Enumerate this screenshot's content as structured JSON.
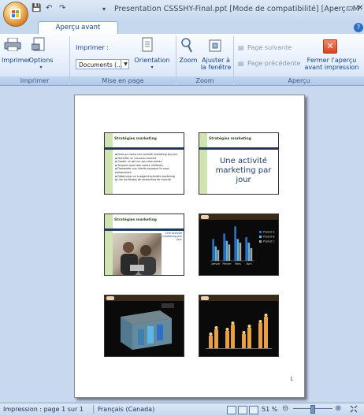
{
  "window": {
    "title": "Presentation CSSSHY-Final.ppt [Mode de compatibilité] [Aperç...M",
    "minimize_glyph": "–",
    "restore_glyph": "▭",
    "close_glyph": "✕",
    "qat_glyphs": [
      "💾",
      "↶",
      "↷",
      "▾"
    ]
  },
  "tabs": {
    "active": "Aperçu avant impression",
    "help_glyph": "?"
  },
  "ribbon": {
    "imprimer_group": {
      "label": "Imprimer",
      "print_label": "Imprimer",
      "options_label": "Options",
      "options_arrow": "▾"
    },
    "mise_en_page_group": {
      "label": "Mise en page",
      "print_what_label": "Imprimer :",
      "print_what_value": "Documents (...",
      "orientation_label": "Orientation",
      "orientation_arrow": "▾"
    },
    "zoom_group": {
      "label": "Zoom",
      "zoom_label": "Zoom",
      "fit_line1": "Ajuster à",
      "fit_line2": "la fenêtre"
    },
    "apercu_group": {
      "label": "Aperçu",
      "next_page": "Page suivante",
      "prev_page": "Page précédente",
      "close_line1": "Fermer l'aperçu",
      "close_line2": "avant impression"
    }
  },
  "slides": [
    {
      "title": "Stratégies marketing",
      "bullets": [
        "Faire au moins une activité marketing par jour",
        "Identifier un nouveau marché",
        "Garder un œil sur ses concurrents",
        "Toujours avoir des cartes d'affaires",
        "Demander aux clients pourquoi ils nous embauchent",
        "Déterminer un budget d'activités marketing",
        "Une les études de recherches de marché"
      ]
    },
    {
      "title": "Stratégies marketing",
      "big_text": "Une activité marketing par jour"
    },
    {
      "title": "Stratégies marketing",
      "small_text": "Une activité marketing par jour"
    }
  ],
  "chart_data": {
    "type": "bar",
    "categories": [
      "Janvier",
      "Février",
      "Mars",
      "Avril"
    ],
    "series": [
      {
        "name": "Produit A",
        "values": [
          60,
          75,
          95,
          65
        ]
      },
      {
        "name": "Produit B",
        "values": [
          40,
          55,
          60,
          50
        ]
      },
      {
        "name": "Produit C",
        "values": [
          30,
          45,
          50,
          35
        ]
      }
    ],
    "ylim": [
      0,
      100
    ],
    "colors": [
      "#2e6fc8",
      "#58b9e8",
      "#a8a8a8"
    ]
  },
  "page_number": "1",
  "status": {
    "page": "Impression : page 1 sur 1",
    "language": "Français (Canada)",
    "zoom": "51 %",
    "zoom_minus": "⊖",
    "zoom_plus": "⊕"
  }
}
